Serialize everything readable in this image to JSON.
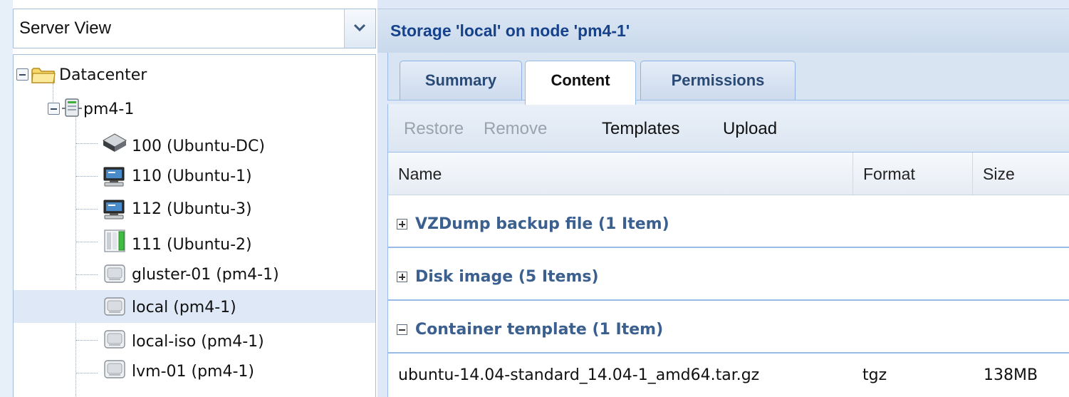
{
  "left_panel": {
    "view_selector": {
      "value": "Server View"
    },
    "tree": {
      "datacenter": "Datacenter",
      "node": "pm4-1",
      "items": [
        {
          "label": "100 (Ubuntu-DC)",
          "icon": "vm-template-icon"
        },
        {
          "label": "110 (Ubuntu-1)",
          "icon": "running-vm-icon"
        },
        {
          "label": "112 (Ubuntu-3)",
          "icon": "running-vm-icon"
        },
        {
          "label": "111 (Ubuntu-2)",
          "icon": "container-icon"
        },
        {
          "label": "gluster-01 (pm4-1)",
          "icon": "storage-icon"
        },
        {
          "label": "local (pm4-1)",
          "icon": "storage-icon",
          "selected": true
        },
        {
          "label": "local-iso (pm4-1)",
          "icon": "storage-icon"
        },
        {
          "label": "lvm-01 (pm4-1)",
          "icon": "storage-icon"
        }
      ]
    }
  },
  "right_panel": {
    "title": "Storage 'local' on node 'pm4-1'",
    "tabs": [
      {
        "label": "Summary",
        "active": false
      },
      {
        "label": "Content",
        "active": true
      },
      {
        "label": "Permissions",
        "active": false
      }
    ],
    "toolbar": {
      "restore": "Restore",
      "remove": "Remove",
      "templates": "Templates",
      "upload": "Upload"
    },
    "columns": {
      "name": "Name",
      "format": "Format",
      "size": "Size"
    },
    "groups": [
      {
        "title": "VZDump backup file (1 Item)",
        "expanded": false
      },
      {
        "title": "Disk image (5 Items)",
        "expanded": false
      },
      {
        "title": "Container template (1 Item)",
        "expanded": true
      }
    ],
    "rows": [
      {
        "name": "ubuntu-14.04-standard_14.04-1_amd64.tar.gz",
        "format": "tgz",
        "size": "138MB"
      }
    ]
  },
  "colors": {
    "header_title": "#15428b",
    "group_title": "#3b5f8e",
    "panel_background": "#dfe8f6",
    "border": "#99bbe8",
    "selection": "#dfe8f6"
  }
}
